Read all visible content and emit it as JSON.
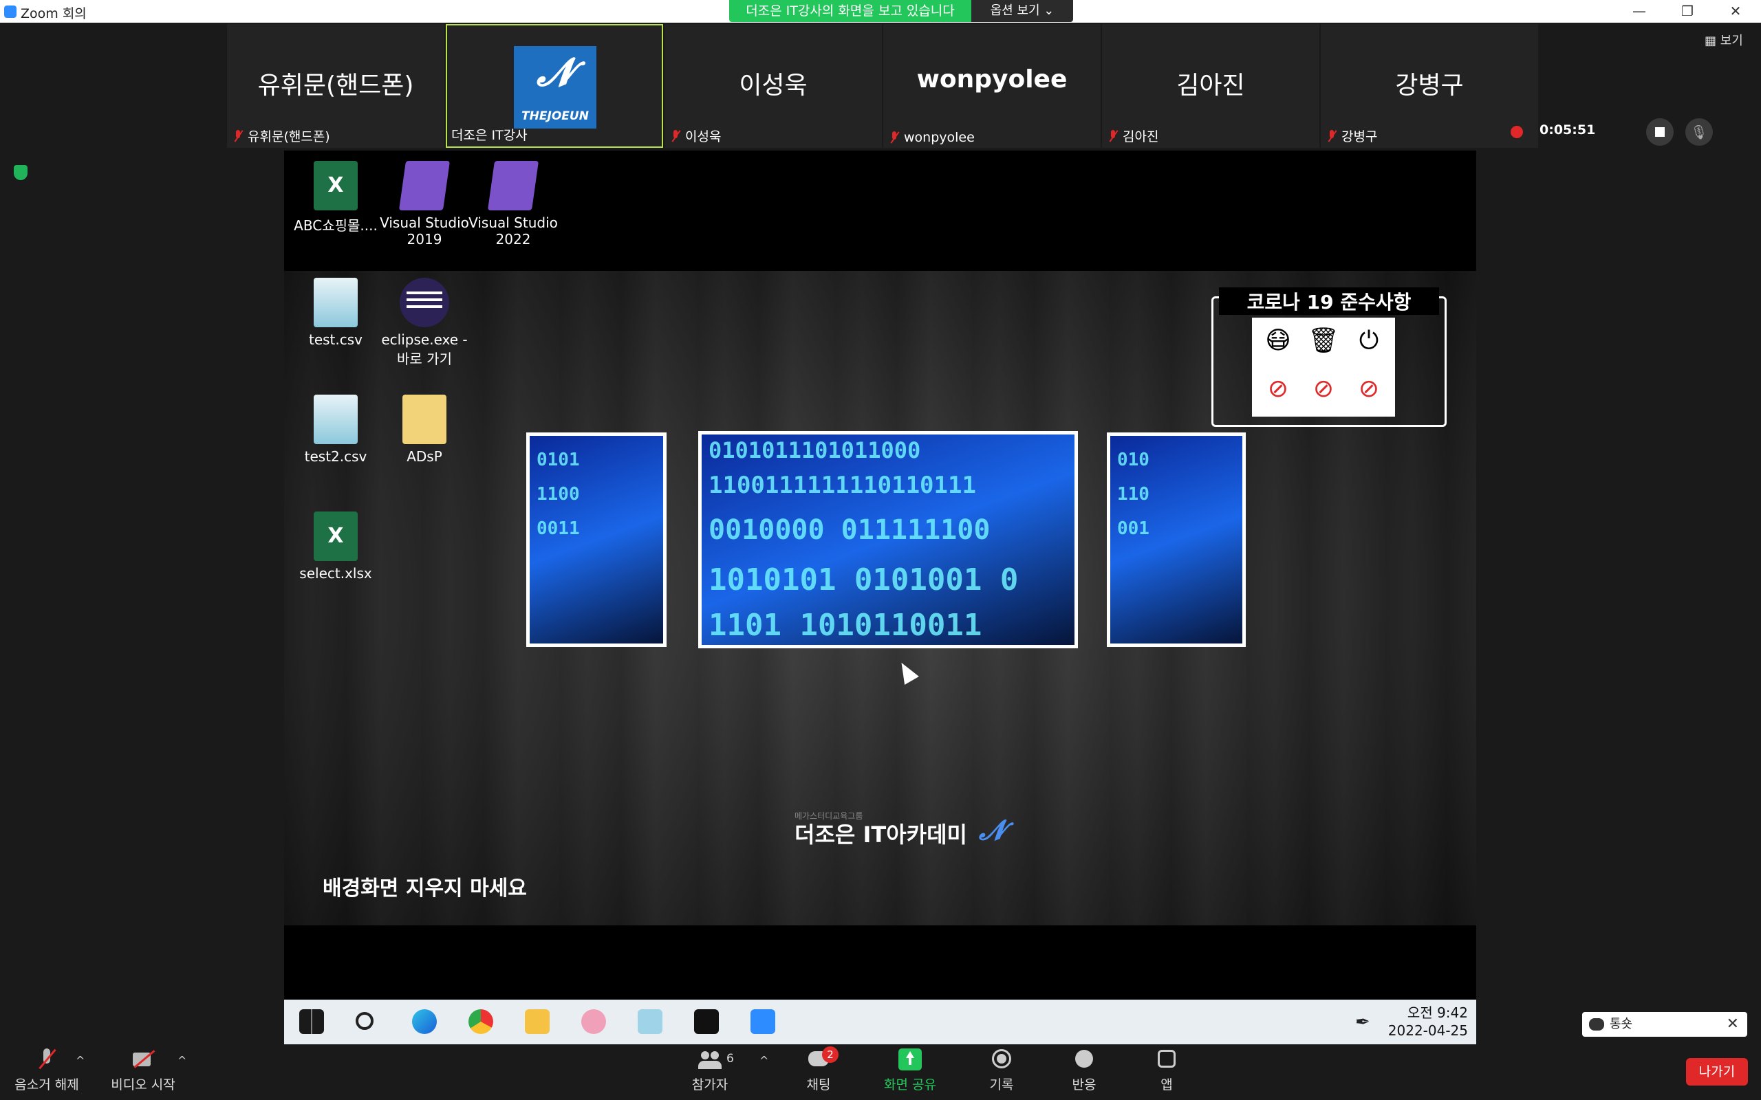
{
  "window": {
    "title": "Zoom 회의",
    "minimize": "—",
    "restore": "❐",
    "close": "✕"
  },
  "share_banner": {
    "text": "더조은 IT강사의 화면을 보고 있습니다",
    "options_label": "옵션 보기 ⌄"
  },
  "view_button": "▦ 보기",
  "participants": [
    {
      "big": "유휘문(핸드폰)",
      "label": "유휘문(핸드폰)"
    },
    {
      "logo_mark": "𝓝",
      "logo_text": "THEJOEUN",
      "label": "더조은 IT강사"
    },
    {
      "big": "이성욱",
      "label": "이성욱"
    },
    {
      "big": "wonpyolee",
      "label": "wonpyolee"
    },
    {
      "big": "김아진",
      "label": "김아진"
    },
    {
      "big": "강병구",
      "label": "강병구"
    }
  ],
  "recording": {
    "time": "0:05:51"
  },
  "desktop_icons": [
    {
      "label": "ABC쇼핑몰....",
      "icon": "excel-icon"
    },
    {
      "label": "Visual Studio 2019",
      "icon": "visual-studio-icon"
    },
    {
      "label": "Visual Studio 2022",
      "icon": "visual-studio-icon"
    },
    {
      "label": "test.csv",
      "icon": "notepad-icon"
    },
    {
      "label": "eclipse.exe - 바로 가기",
      "icon": "eclipse-icon"
    },
    {
      "label": "test2.csv",
      "icon": "notepad-icon"
    },
    {
      "label": "ADsP",
      "icon": "folder-icon"
    },
    {
      "label": "select.xlsx",
      "icon": "excel-icon"
    }
  ],
  "photo_digits": {
    "left": [
      "0101",
      "1100",
      "0011"
    ],
    "center": [
      "0101011101011000",
      "1100111111110110111",
      "0010000  011111100",
      "1010101 0101001 0",
      "1101 1010110011"
    ],
    "right": [
      "010",
      "110",
      "001"
    ]
  },
  "covid": {
    "title": "코로나 19 준수사항"
  },
  "brand": {
    "sub": "메가스터디교육그룹",
    "name": "더조은 IT아카데미",
    "mark": "𝓝"
  },
  "notice": "배경화면 지우지 마세요",
  "taskbar": {
    "time": "오전 9:42",
    "date": "2022-04-25",
    "pen": "✒"
  },
  "controls": {
    "mute": "음소거 해제",
    "video": "비디오 시작",
    "participants": "참가자",
    "participants_count": "6",
    "chat": "채팅",
    "chat_badge": "2",
    "share": "화면 공유",
    "record": "기록",
    "reactions": "반응",
    "apps": "앱",
    "caret": "^",
    "leave": "나가기"
  },
  "chat_popup": {
    "text": "통숏",
    "close": "✕"
  },
  "colors": {
    "share_green": "#23c65a",
    "record_red": "#e02828",
    "zoom_blue": "#2d8cff"
  }
}
